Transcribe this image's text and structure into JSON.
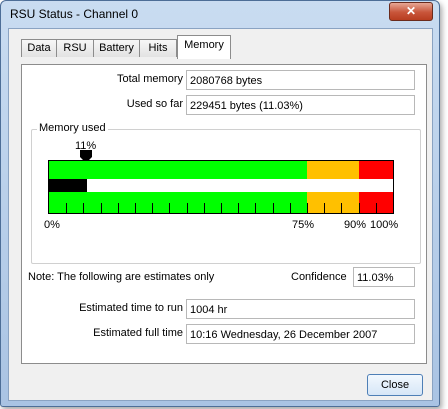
{
  "window": {
    "title": "RSU Status - Channel 0",
    "close_glyph": "✕"
  },
  "tabs": [
    {
      "label": "Data"
    },
    {
      "label": "RSU"
    },
    {
      "label": "Battery"
    },
    {
      "label": "Hits"
    },
    {
      "label": "Memory",
      "selected": true
    }
  ],
  "memory": {
    "total_label": "Total memory",
    "total_value": "2080768 bytes",
    "used_label": "Used so far",
    "used_value": "229451 bytes (11.03%)",
    "group_title": "Memory used",
    "used_fraction": 0.1103,
    "marker_label": "11%",
    "zone_labels": {
      "start": "0%",
      "yellow": "75%",
      "red": "90%",
      "end": "100%"
    },
    "zone_colors": {
      "green": "#00ff00",
      "yellow": "#ffc000",
      "red": "#ff0000",
      "used": "#000000"
    },
    "zones": {
      "yellow_start": 0.75,
      "red_start": 0.9
    }
  },
  "estimates": {
    "note": "Note: The following are estimates only",
    "confidence_label": "Confidence",
    "confidence_value": "11.03%",
    "time_to_run_label": "Estimated time to run",
    "time_to_run_value": "1004 hr",
    "full_time_label": "Estimated full time",
    "full_time_value": "10:16 Wednesday, 26 December 2007"
  },
  "buttons": {
    "close_label": "Close"
  }
}
